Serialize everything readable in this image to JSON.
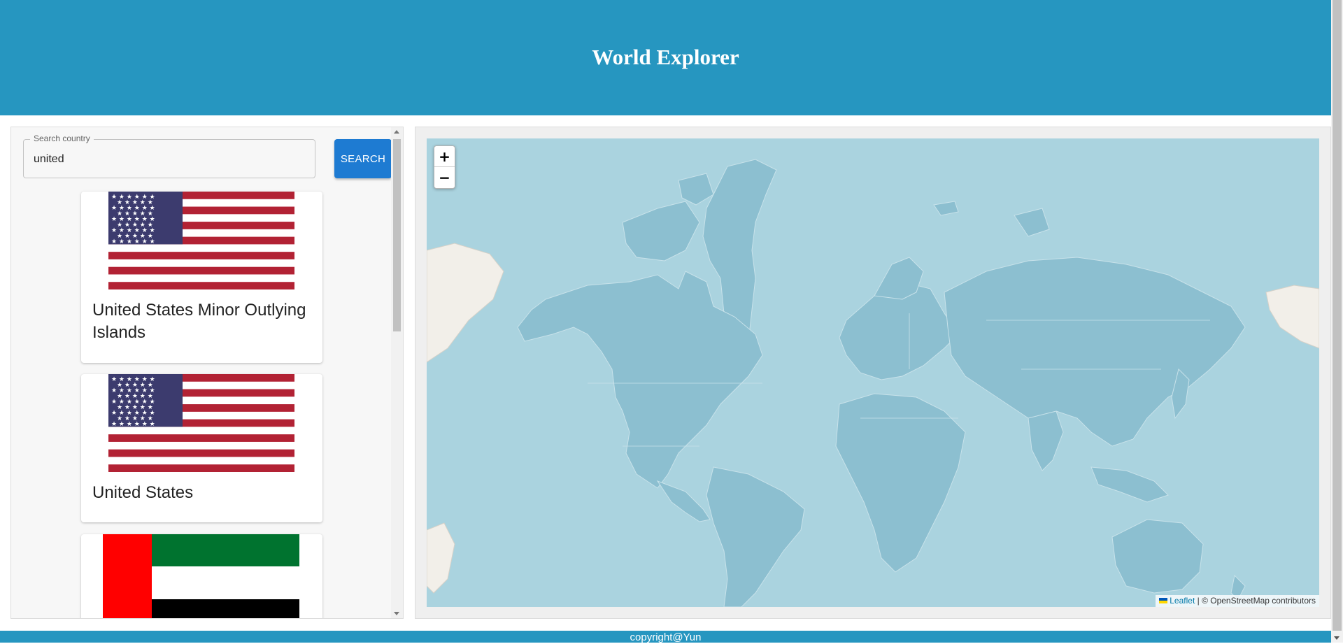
{
  "header": {
    "title": "World Explorer"
  },
  "search": {
    "label": "Search country",
    "value": "united",
    "button_label": "SEARCH"
  },
  "results": [
    {
      "name": "United States Minor Outlying Islands",
      "flag": "us-flag"
    },
    {
      "name": "United States",
      "flag": "us-flag"
    },
    {
      "name": "",
      "flag": "uae-flag"
    }
  ],
  "map": {
    "zoom_in": "+",
    "zoom_out": "−",
    "attribution_link": "Leaflet",
    "attribution_text": " | © OpenStreetMap contributors"
  },
  "footer": {
    "text": "copyright@Yun"
  },
  "colors": {
    "header": "#2696c0",
    "button": "#1e7bd2",
    "water": "#aad3df",
    "land": "#8cbfd0"
  }
}
